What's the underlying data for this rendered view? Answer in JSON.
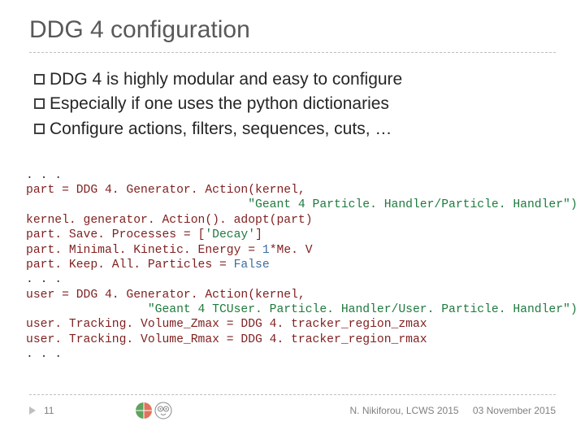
{
  "title": "DDG 4 configuration",
  "bullets": [
    "DDG 4 is highly modular and easy to configure",
    "Especially if one uses the python dictionaries",
    "Configure actions, filters, sequences, cuts, …"
  ],
  "code": {
    "l0": ". . .",
    "l1a": "part = DDG 4. Generator. Action(kernel,",
    "l1b": "                               \"Geant 4 Particle. Handler/Particle. Handler\")",
    "l2": "kernel. generator. Action(). adopt(part)",
    "l3a": "part. Save. Processes = [",
    "l3b": "'Decay'",
    "l3c": "]",
    "l4a": "part. Minimal. Kinetic. Energy = ",
    "l4b": "1",
    "l4c": "*Me. V",
    "l5a": "part. Keep. All. Particles = ",
    "l5b": "False",
    "l6": ". . .",
    "l7a": "user = DDG 4. Generator. Action(kernel,",
    "l7b": "                 \"Geant 4 TCUser. Particle. Handler/User. Particle. Handler\")",
    "l8": "user. Tracking. Volume_Zmax = DDG 4. tracker_region_zmax",
    "l9": "user. Tracking. Volume_Rmax = DDG 4. tracker_region_rmax",
    "l10": ". . ."
  },
  "footer": {
    "page": "11",
    "credits": "N. Nikiforou, LCWS 2015",
    "date": "03 November 2015"
  }
}
